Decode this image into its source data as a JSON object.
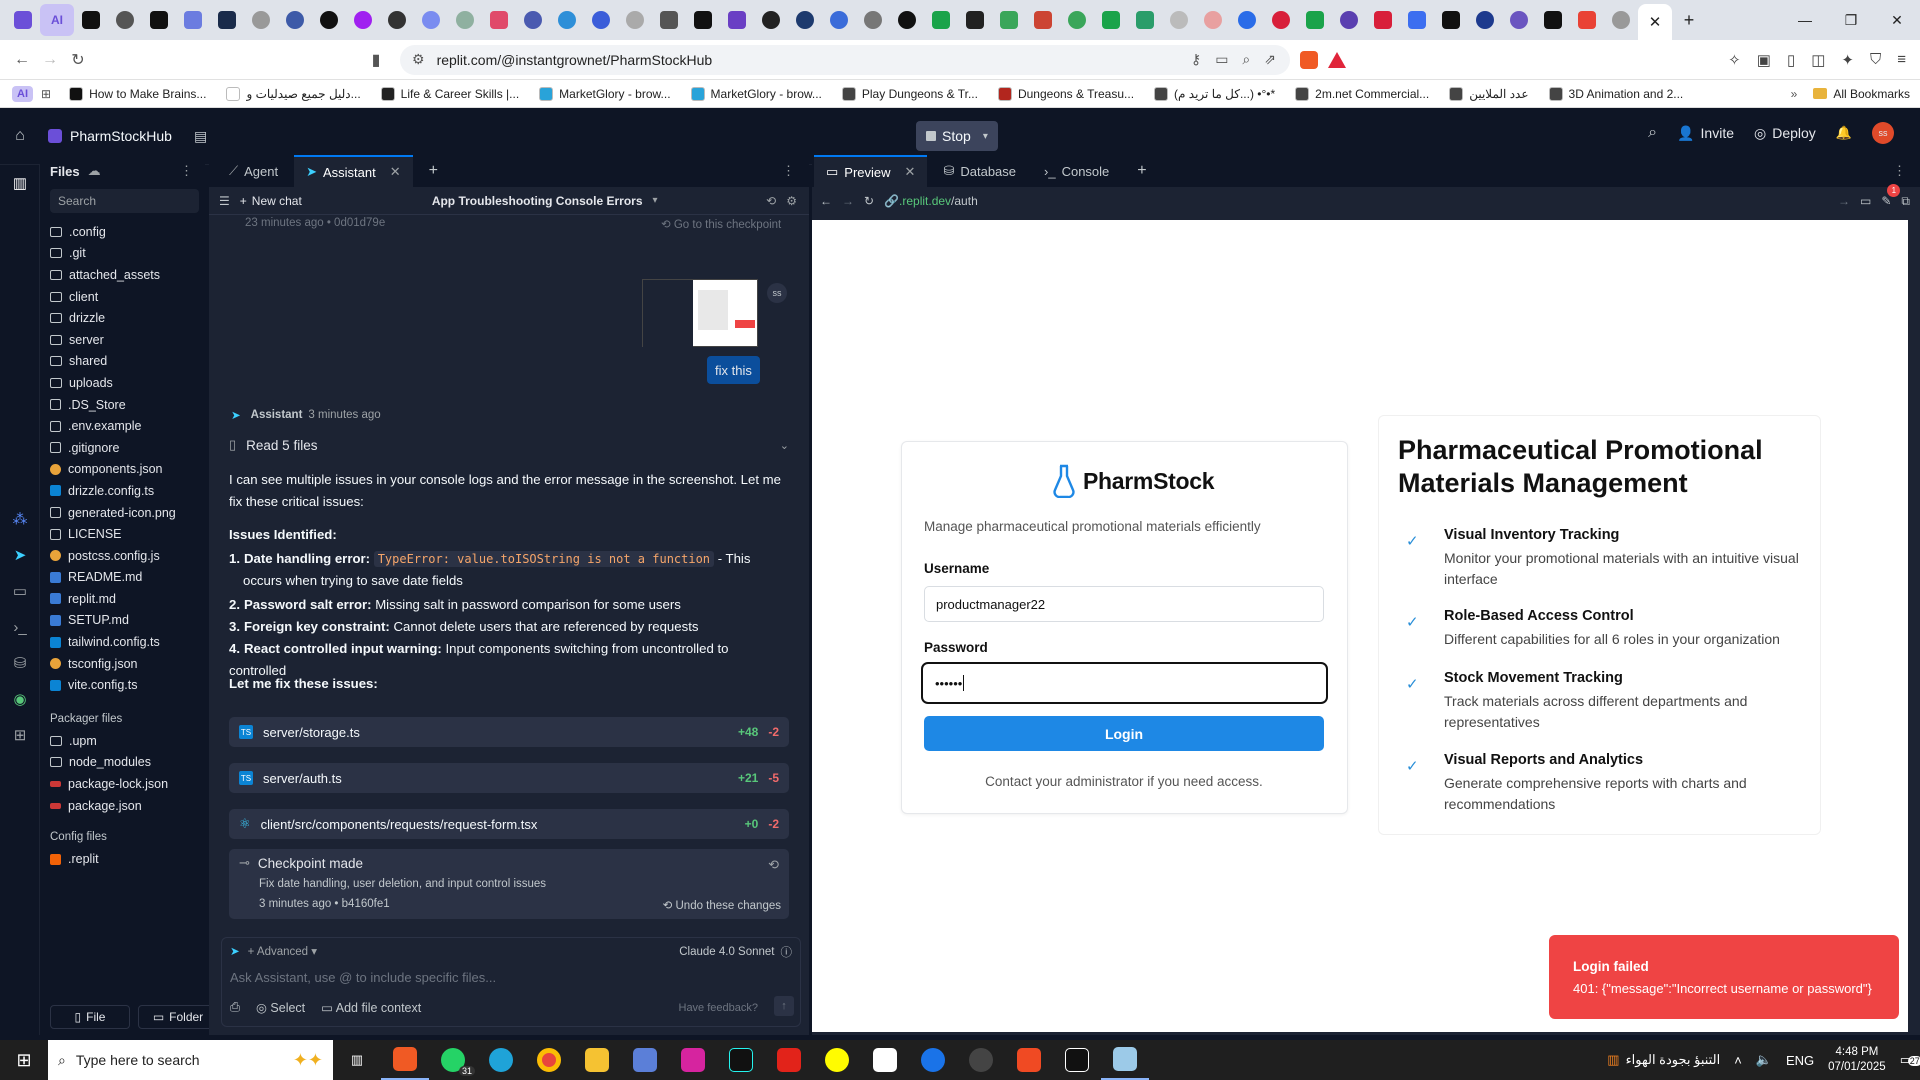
{
  "browser": {
    "address": "replit.com/@instantgrownet/PharmStockHub",
    "bookmarks": [
      {
        "label": "How to Make Brains...",
        "color": "#111111"
      },
      {
        "label": "دليل جميع صيدليات و...",
        "color": "#ffffff"
      },
      {
        "label": "Life & Career Skills |...",
        "color": "#222222"
      },
      {
        "label": "MarketGlory - brow...",
        "color": "#29a3d9"
      },
      {
        "label": "MarketGlory - brow...",
        "color": "#29a3d9"
      },
      {
        "label": "Play Dungeons & Tr...",
        "color": "#444444"
      },
      {
        "label": "Dungeons & Treasu...",
        "color": "#b2261e"
      },
      {
        "label": "(كل ما تريد م...) •°•*",
        "color": "#444444"
      },
      {
        "label": "2m.net Commercial...",
        "color": "#444444"
      },
      {
        "label": "عدد الملايين",
        "color": "#444444"
      },
      {
        "label": "3D Animation and 2...",
        "color": "#444444"
      }
    ],
    "all_bookmarks": "All Bookmarks",
    "ai_label": "AI"
  },
  "header": {
    "project": "PharmStockHub",
    "stop": "Stop",
    "invite": "Invite",
    "deploy": "Deploy",
    "avatar": "ss"
  },
  "files": {
    "title": "Files",
    "search": "Search",
    "items": [
      ".config",
      ".git",
      "attached_assets",
      "client",
      "drizzle",
      "server",
      "shared",
      "uploads",
      ".DS_Store",
      ".env.example",
      ".gitignore",
      "components.json",
      "drizzle.config.ts",
      "generated-icon.png",
      "LICENSE",
      "postcss.config.js",
      "README.md",
      "replit.md",
      "SETUP.md",
      "tailwind.config.ts",
      "tsconfig.json",
      "vite.config.ts"
    ],
    "packager_title": "Packager files",
    "packager": [
      ".upm",
      "node_modules",
      "package-lock.json",
      "package.json"
    ],
    "config_title": "Config files",
    "config": [
      ".replit"
    ],
    "btn_file": "File",
    "btn_folder": "Folder"
  },
  "chat": {
    "tab_agent": "Agent",
    "tab_assistant": "Assistant",
    "new_chat": "New chat",
    "chat_title": "App Troubleshooting Console Errors",
    "top_time": "23 minutes ago • 0d01d79e",
    "goto_checkpoint": "Go to this checkpoint",
    "user_msg": "fix this",
    "user_avatar": "ss",
    "assistant_name": "Assistant",
    "assistant_time": "3 minutes ago",
    "read_files": "Read 5 files",
    "intro": "I can see multiple issues in your console logs and the error message in the screenshot. Let me fix these critical issues:",
    "issues_title": "Issues Identified:",
    "issues": [
      {
        "n": "1.",
        "b": "Date handling error:",
        "code": "TypeError: value.toISOString is not a function",
        "t": " - This occurs when trying to save date fields"
      },
      {
        "n": "2.",
        "b": "Password salt error:",
        "code": "",
        "t": " Missing salt in password comparison for some users"
      },
      {
        "n": "3.",
        "b": "Foreign key constraint:",
        "code": "",
        "t": " Cannot delete users that are referenced by requests"
      },
      {
        "n": "4.",
        "b": "React controlled input warning:",
        "code": "",
        "t": " Input components switching from uncontrolled to controlled"
      }
    ],
    "fix_line": "Let me fix these issues:",
    "changes": [
      {
        "file": "server/storage.ts",
        "add": "+48",
        "del": "-2"
      },
      {
        "file": "server/auth.ts",
        "add": "+21",
        "del": "-5"
      },
      {
        "file": "client/src/components/requests/request-form.tsx",
        "add": "+0",
        "del": "-2"
      }
    ],
    "checkpoint_title": "Checkpoint made",
    "checkpoint_desc": "Fix date handling, user deletion, and input control issues",
    "checkpoint_time": "3 minutes ago • b4160fe1",
    "undo": "Undo these changes",
    "advanced": "Advanced",
    "model": "Claude 4.0 Sonnet",
    "placeholder": "Ask Assistant, use @ to include specific files...",
    "select": "Select",
    "add_context": "Add file context",
    "feedback": "Have feedback?"
  },
  "preview": {
    "tab_preview": "Preview",
    "tab_database": "Database",
    "tab_console": "Console",
    "url_prefix": ".replit.dev",
    "url_path": "/auth",
    "notif_count": "1"
  },
  "app": {
    "brand": "PharmStock",
    "subtitle": "Manage pharmaceutical promotional materials efficiently",
    "username_label": "Username",
    "username_value": "productmanager22",
    "password_label": "Password",
    "password_value": "••••••",
    "login": "Login",
    "contact": "Contact your administrator if you need access.",
    "hero_title": "Pharmaceutical Promotional Materials Management",
    "features": [
      {
        "title": "Visual Inventory Tracking",
        "desc": "Monitor your promotional materials with an intuitive visual interface"
      },
      {
        "title": "Role-Based Access Control",
        "desc": "Different capabilities for all 6 roles in your organization"
      },
      {
        "title": "Stock Movement Tracking",
        "desc": "Track materials across different departments and representatives"
      },
      {
        "title": "Visual Reports and Analytics",
        "desc": "Generate comprehensive reports with charts and recommendations"
      }
    ],
    "toast_title": "Login failed",
    "toast_msg": "401: {\"message\":\"Incorrect username or password\"}"
  },
  "taskbar": {
    "search": "Type here to search",
    "weather": "التنبؤ بجودة الهواء",
    "lang": "ENG",
    "time": "4:48 PM",
    "date": "07/01/2025",
    "notif": "27",
    "whatsapp_badge": "31"
  },
  "colors": {
    "accent": "#0079f2",
    "login_button": "#1e88e5",
    "toast": "#ef4444",
    "stop": "#3c445c"
  }
}
